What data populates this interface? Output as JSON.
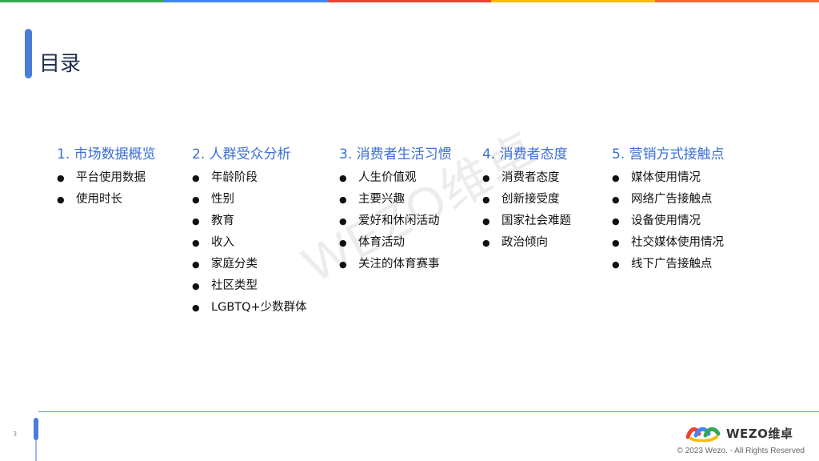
{
  "slide": {
    "title": "目录",
    "page_number": "3",
    "watermark": "WEZO维卓",
    "copyright": "© 2023 Wezo. - All Rights Reserved",
    "logo_text": "WEZO维卓"
  },
  "colors": {
    "accent_blue": "#3b6fd6",
    "bar_green": "#34a853",
    "bar_blue": "#4285f4",
    "bar_red": "#ea4335",
    "bar_yellow": "#fbbc05",
    "bar_orange": "#f06a35"
  },
  "icons": {
    "bullet": "bullet-dot-icon",
    "logo": "wezo-logo-icon"
  },
  "sections": [
    {
      "heading": "1. 市场数据概览",
      "items": [
        "平台使用数据",
        "使用时长"
      ]
    },
    {
      "heading": "2. 人群受众分析",
      "items": [
        "年龄阶段",
        "性别",
        "教育",
        "收入",
        "家庭分类",
        "社区类型",
        "LGBTQ+少数群体"
      ]
    },
    {
      "heading": "3. 消费者生活习惯",
      "items": [
        "人生价值观",
        "主要兴趣",
        "爱好和休闲活动",
        "体育活动",
        "关注的体育赛事"
      ]
    },
    {
      "heading": "4. 消费者态度",
      "items": [
        "消费者态度",
        "创新接受度",
        "国家社会难题",
        "政治倾向"
      ]
    },
    {
      "heading": "5. 营销方式接触点",
      "items": [
        "媒体使用情况",
        "网络广告接触点",
        "设备使用情况",
        "社交媒体使用情况",
        "线下广告接触点"
      ]
    }
  ]
}
